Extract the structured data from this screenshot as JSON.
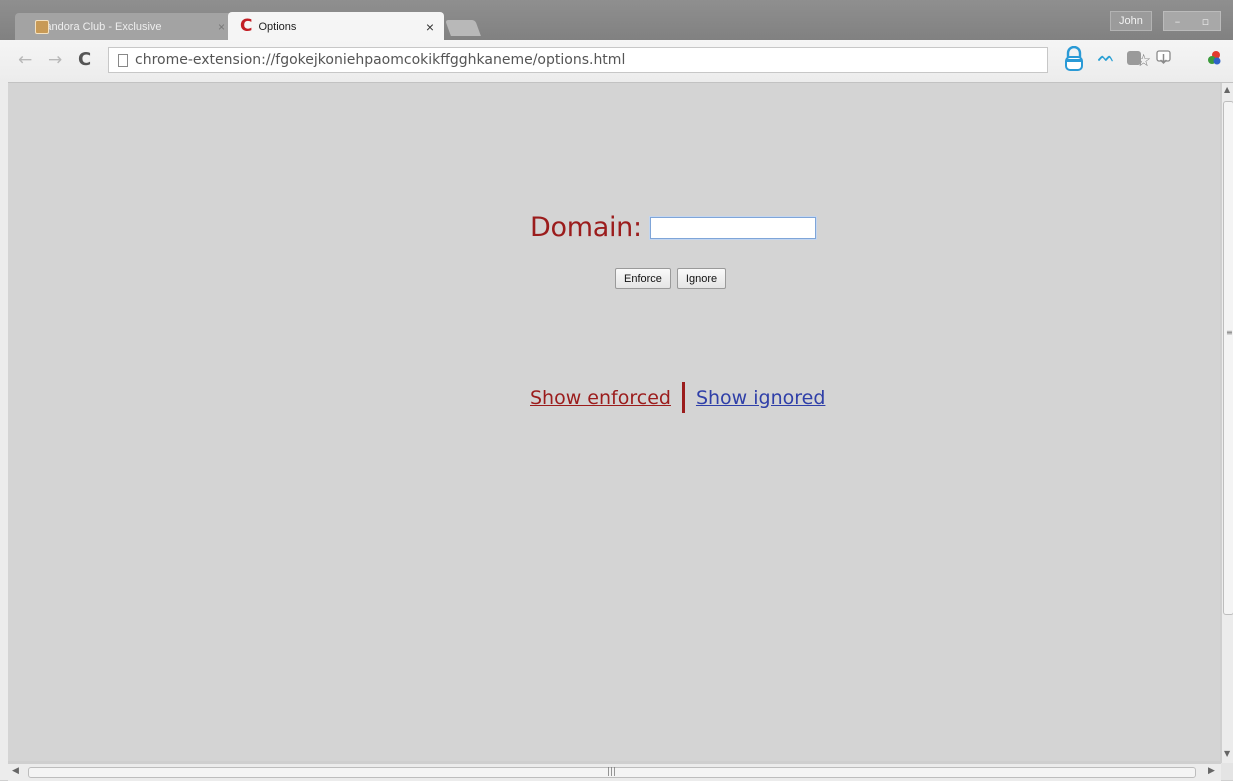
{
  "browser": {
    "tabs": [
      {
        "title": "Pandora Club - Exclusive",
        "active": false
      },
      {
        "title": "Options",
        "active": true
      }
    ],
    "user_badge": "John",
    "url": "chrome-extension://fgokejkoniehpaomcokikffgghkaneme/options.html",
    "accent_color": "#c21e25"
  },
  "page": {
    "domain_label": "Domain:",
    "domain_input": {
      "value": "",
      "placeholder": ""
    },
    "buttons": {
      "enforce": "Enforce",
      "ignore": "Ignore"
    },
    "links": {
      "show_enforced": "Show enforced",
      "show_ignored": "Show ignored"
    },
    "colors": {
      "label": "#9b1c1c",
      "link_ignored": "#2f3fa8",
      "background": "#d4d4d4"
    }
  },
  "icons": [
    "back-arrow-icon",
    "forward-arrow-icon",
    "reload-icon",
    "page-icon",
    "star-icon",
    "lock-extension-icon",
    "wave-extension-icon",
    "box-extension-icon",
    "download-extension-icon",
    "color-extension-icon"
  ]
}
